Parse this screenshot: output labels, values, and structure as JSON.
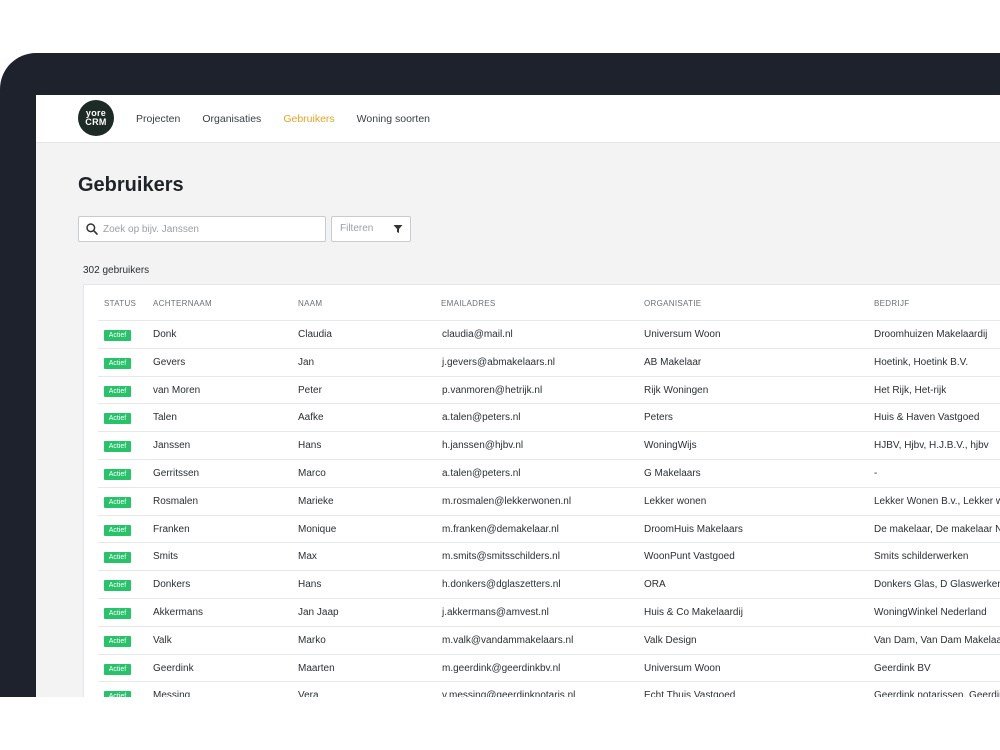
{
  "nav": {
    "logo_line1": "yore",
    "logo_line2": "CRM",
    "links": [
      "Projecten",
      "Organisaties",
      "Gebruikers",
      "Woning soorten"
    ]
  },
  "page": {
    "title": "Gebruikers",
    "search_placeholder": "Zoek op bijv. Janssen",
    "filter_label": "Filteren",
    "count_text": "302 gebruikers"
  },
  "table": {
    "columns": [
      "STATUS",
      "ACHTERNAAM",
      "NAAM",
      "EMAILADRES",
      "ORGANISATIE",
      "BEDRIJF"
    ],
    "rows": [
      {
        "status": "Actief",
        "achternaam": "Donk",
        "naam": "Claudia",
        "email": "claudia@mail.nl",
        "organisatie": "Universum Woon",
        "bedrijf": "Droomhuizen Makelaardij"
      },
      {
        "status": "Actief",
        "achternaam": "Gevers",
        "naam": "Jan",
        "email": "j.gevers@abmakelaars.nl",
        "organisatie": "AB Makelaar",
        "bedrijf": "Hoetink, Hoetink B.V."
      },
      {
        "status": "Actief",
        "achternaam": "van Moren",
        "naam": "Peter",
        "email": "p.vanmoren@hetrijk.nl",
        "organisatie": "Rijk Woningen",
        "bedrijf": "Het Rijk,  Het-rijk"
      },
      {
        "status": "Actief",
        "achternaam": "Talen",
        "naam": "Aafke",
        "email": "a.talen@peters.nl",
        "organisatie": "Peters",
        "bedrijf": "Huis & Haven Vastgoed"
      },
      {
        "status": "Actief",
        "achternaam": "Janssen",
        "naam": "Hans",
        "email": "h.janssen@hjbv.nl",
        "organisatie": "WoningWijs",
        "bedrijf": "HJBV, Hjbv, H.J.B.V., hjbv"
      },
      {
        "status": "Actief",
        "achternaam": "Gerritssen",
        "naam": "Marco",
        "email": "a.talen@peters.nl",
        "organisatie": "G Makelaars",
        "bedrijf": "-"
      },
      {
        "status": "Actief",
        "achternaam": "Rosmalen",
        "naam": "Marieke",
        "email": "m.rosmalen@lekkerwonen.nl",
        "organisatie": "Lekker wonen",
        "bedrijf": "Lekker Wonen B.v., Lekker wo"
      },
      {
        "status": "Actief",
        "achternaam": "Franken",
        "naam": "Monique",
        "email": "m.franken@demakelaar.nl",
        "organisatie": "DroomHuis Makelaars",
        "bedrijf": "De makelaar, De makelaar Ni"
      },
      {
        "status": "Actief",
        "achternaam": "Smits",
        "naam": "Max",
        "email": "m.smits@smitsschilders.nl",
        "organisatie": "WoonPunt Vastgoed",
        "bedrijf": "Smits schilderwerken"
      },
      {
        "status": "Actief",
        "achternaam": "Donkers",
        "naam": "Hans",
        "email": "h.donkers@dglaszetters.nl",
        "organisatie": "ORA",
        "bedrijf": "Donkers Glas, D Glaswerken"
      },
      {
        "status": "Actief",
        "achternaam": "Akkermans",
        "naam": "Jan Jaap",
        "email": "j.akkermans@amvest.nl",
        "organisatie": "Huis & Co Makelaardij",
        "bedrijf": "WoningWinkel Nederland"
      },
      {
        "status": "Actief",
        "achternaam": "Valk",
        "naam": "Marko",
        "email": "m.valk@vandammakelaars.nl",
        "organisatie": "Valk Design",
        "bedrijf": "Van Dam, Van Dam Makelaar"
      },
      {
        "status": "Actief",
        "achternaam": "Geerdink",
        "naam": "Maarten",
        "email": "m.geerdink@geerdinkbv.nl",
        "organisatie": "Universum Woon",
        "bedrijf": "Geerdink BV"
      },
      {
        "status": "Actief",
        "achternaam": "Messing",
        "naam": "Vera",
        "email": "v.messing@geerdinknotaris.nl",
        "organisatie": "Echt Thuis Vastgoed",
        "bedrijf": "Geerdink notarissen, Geerdin"
      }
    ]
  },
  "colors": {
    "accent": "#e2a624",
    "badge": "#27c26a",
    "frame": "#1e222c"
  }
}
